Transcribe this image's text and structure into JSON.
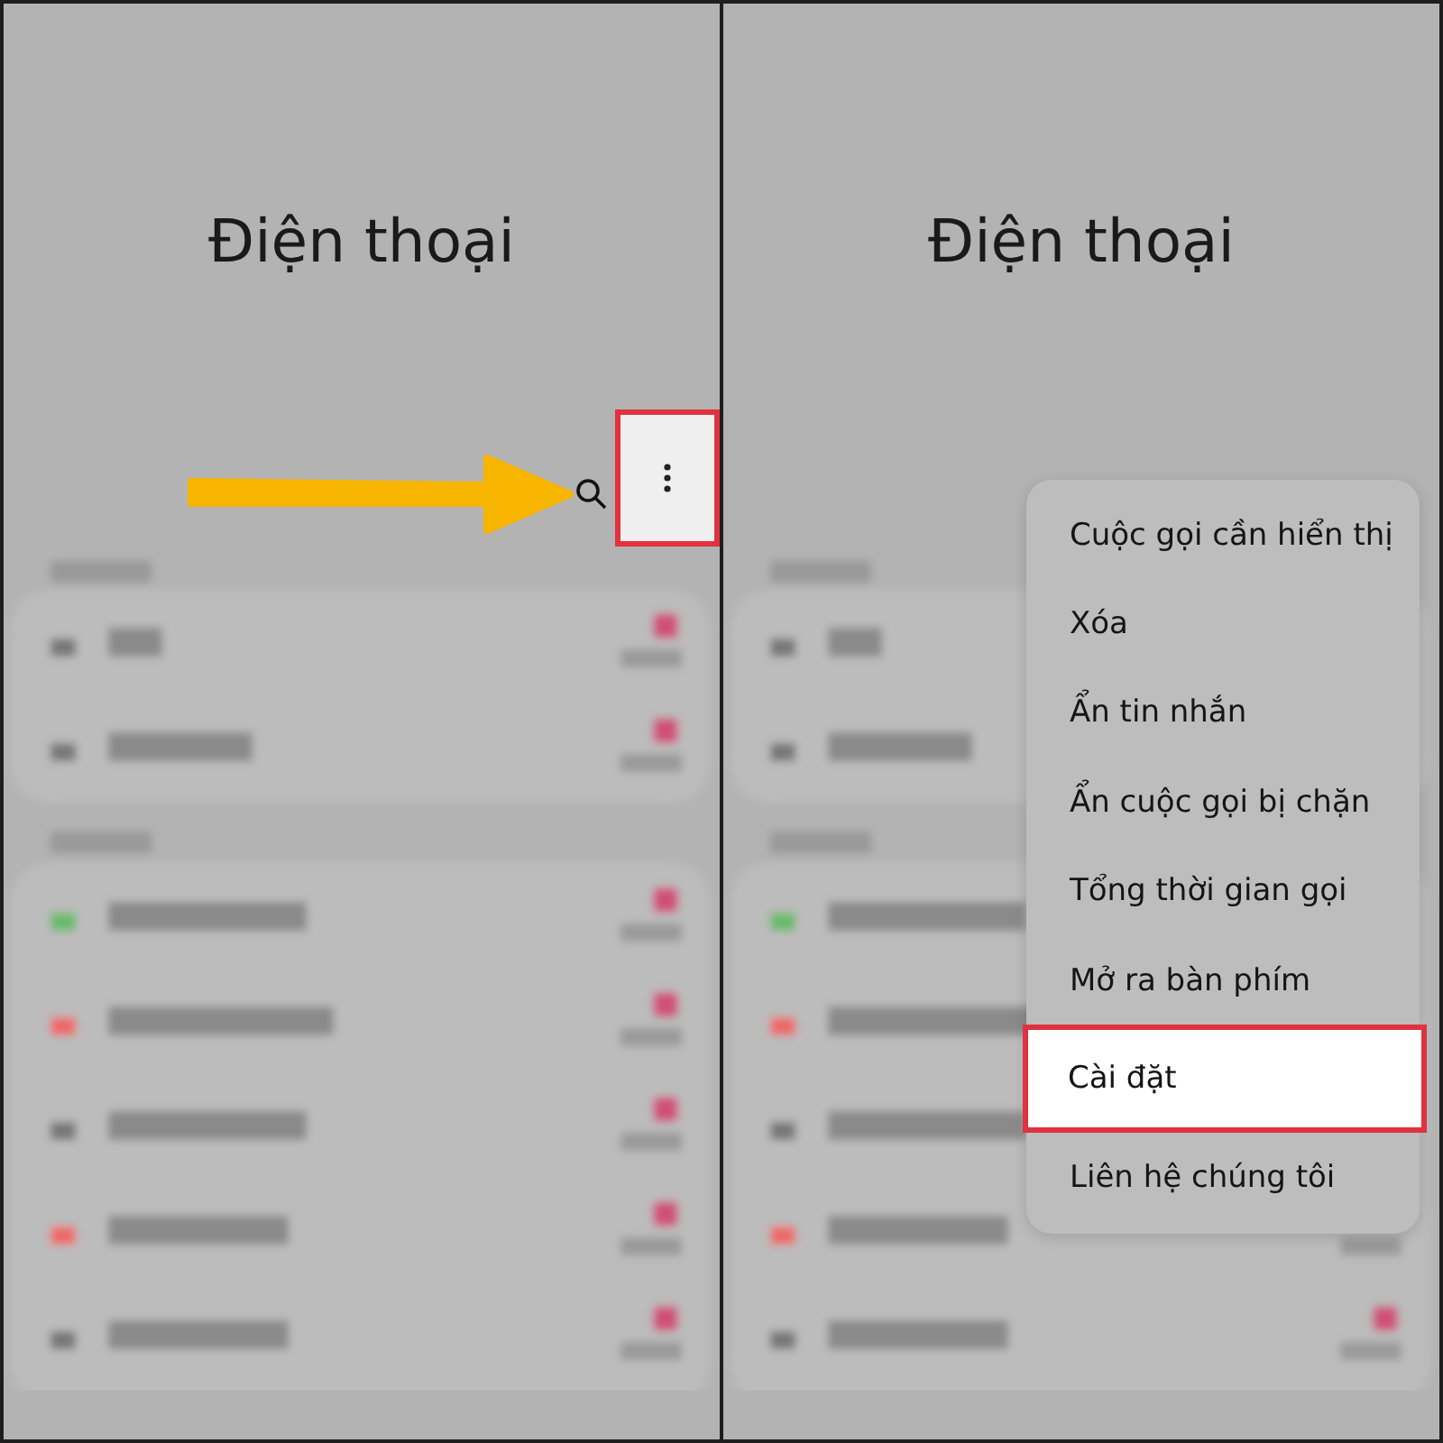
{
  "panels": [
    {
      "title": "Điện thoại",
      "more_button": {
        "highlighted": true
      },
      "arrow": {
        "kind": "pointer"
      }
    },
    {
      "title": "Điện thoại",
      "menu": {
        "items": [
          {
            "label": "Cuộc gọi cần hiển thị",
            "selected": false
          },
          {
            "label": "Xóa",
            "selected": false
          },
          {
            "label": "Ẩn tin nhắn",
            "selected": false
          },
          {
            "label": "Ẩn cuộc gọi bị chặn",
            "selected": false
          },
          {
            "label": "Tổng thời gian gọi",
            "selected": false
          },
          {
            "label": "Mở ra bàn phím",
            "selected": false
          },
          {
            "label": "Cài đặt",
            "selected": true
          },
          {
            "label": "Liên hệ chúng tôi",
            "selected": false
          }
        ]
      }
    }
  ]
}
